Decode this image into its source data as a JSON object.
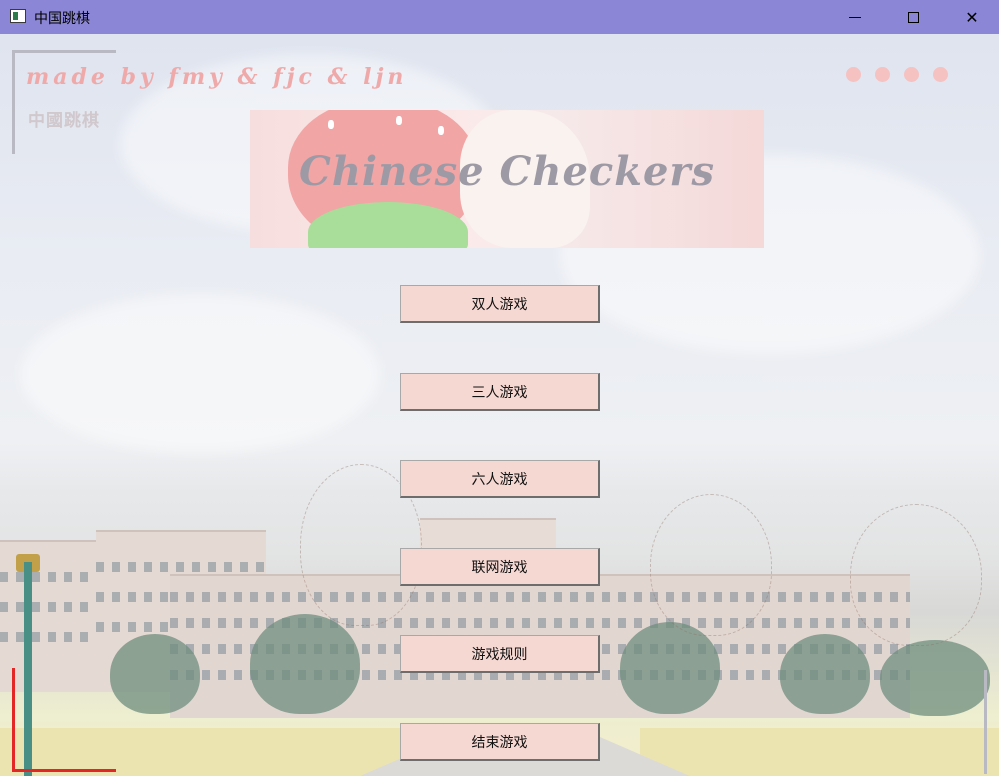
{
  "window": {
    "title": "中国跳棋",
    "controls": {
      "minimize": "minimize",
      "maximize": "maximize",
      "close": "close"
    }
  },
  "header": {
    "credit": "made by fmy & fjc & ljn",
    "subtitle": "中國跳棋",
    "banner_title": "Chinese Checkers"
  },
  "menu": {
    "buttons": [
      {
        "id": "two-player",
        "label": "双人游戏"
      },
      {
        "id": "three-player",
        "label": "三人游戏"
      },
      {
        "id": "six-player",
        "label": "六人游戏"
      },
      {
        "id": "online",
        "label": "联网游戏"
      },
      {
        "id": "rules",
        "label": "游戏规则"
      },
      {
        "id": "exit",
        "label": "结束游戏"
      }
    ]
  },
  "decor": {
    "dot_count": 4,
    "dot_color": "#f6c1c1",
    "accent_corner_color": "#e32626",
    "titlebar_color": "#8b87d6",
    "button_color": "#f6d8d2"
  }
}
